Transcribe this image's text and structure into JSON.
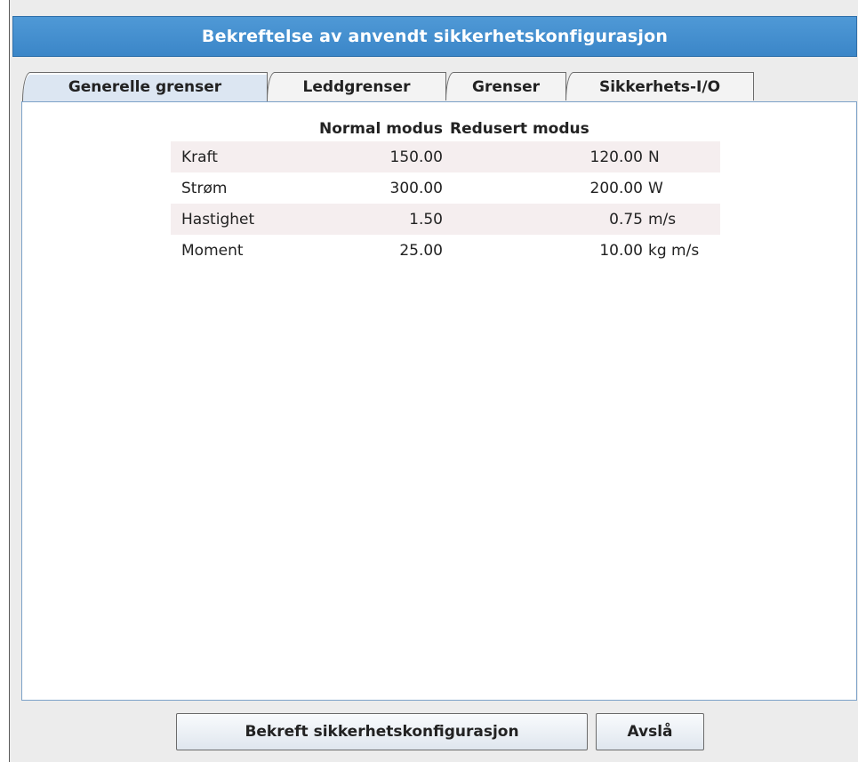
{
  "dialog": {
    "title": "Bekreftelse av anvendt sikkerhetskonfigurasjon"
  },
  "tabs": [
    {
      "label": "Generelle grenser",
      "active": true
    },
    {
      "label": "Leddgrenser",
      "active": false
    },
    {
      "label": "Grenser",
      "active": false
    },
    {
      "label": "Sikkerhets-I/O",
      "active": false
    }
  ],
  "table": {
    "headers": {
      "normal": "Normal modus",
      "reduced": "Redusert modus"
    },
    "rows": [
      {
        "label": "Kraft",
        "normal": "150.00",
        "reduced": "120.00",
        "unit": "N"
      },
      {
        "label": "Strøm",
        "normal": "300.00",
        "reduced": "200.00",
        "unit": "W"
      },
      {
        "label": "Hastighet",
        "normal": "1.50",
        "reduced": "0.75",
        "unit": "m/s"
      },
      {
        "label": "Moment",
        "normal": "25.00",
        "reduced": "10.00",
        "unit": "kg m/s"
      }
    ]
  },
  "buttons": {
    "confirm": "Bekreft sikkerhetskonfigurasjon",
    "reject": "Avslå"
  },
  "colors": {
    "title_bar": "#3b86c8",
    "row_shade": "#f5eeef",
    "active_tab": "#dce6f2"
  }
}
